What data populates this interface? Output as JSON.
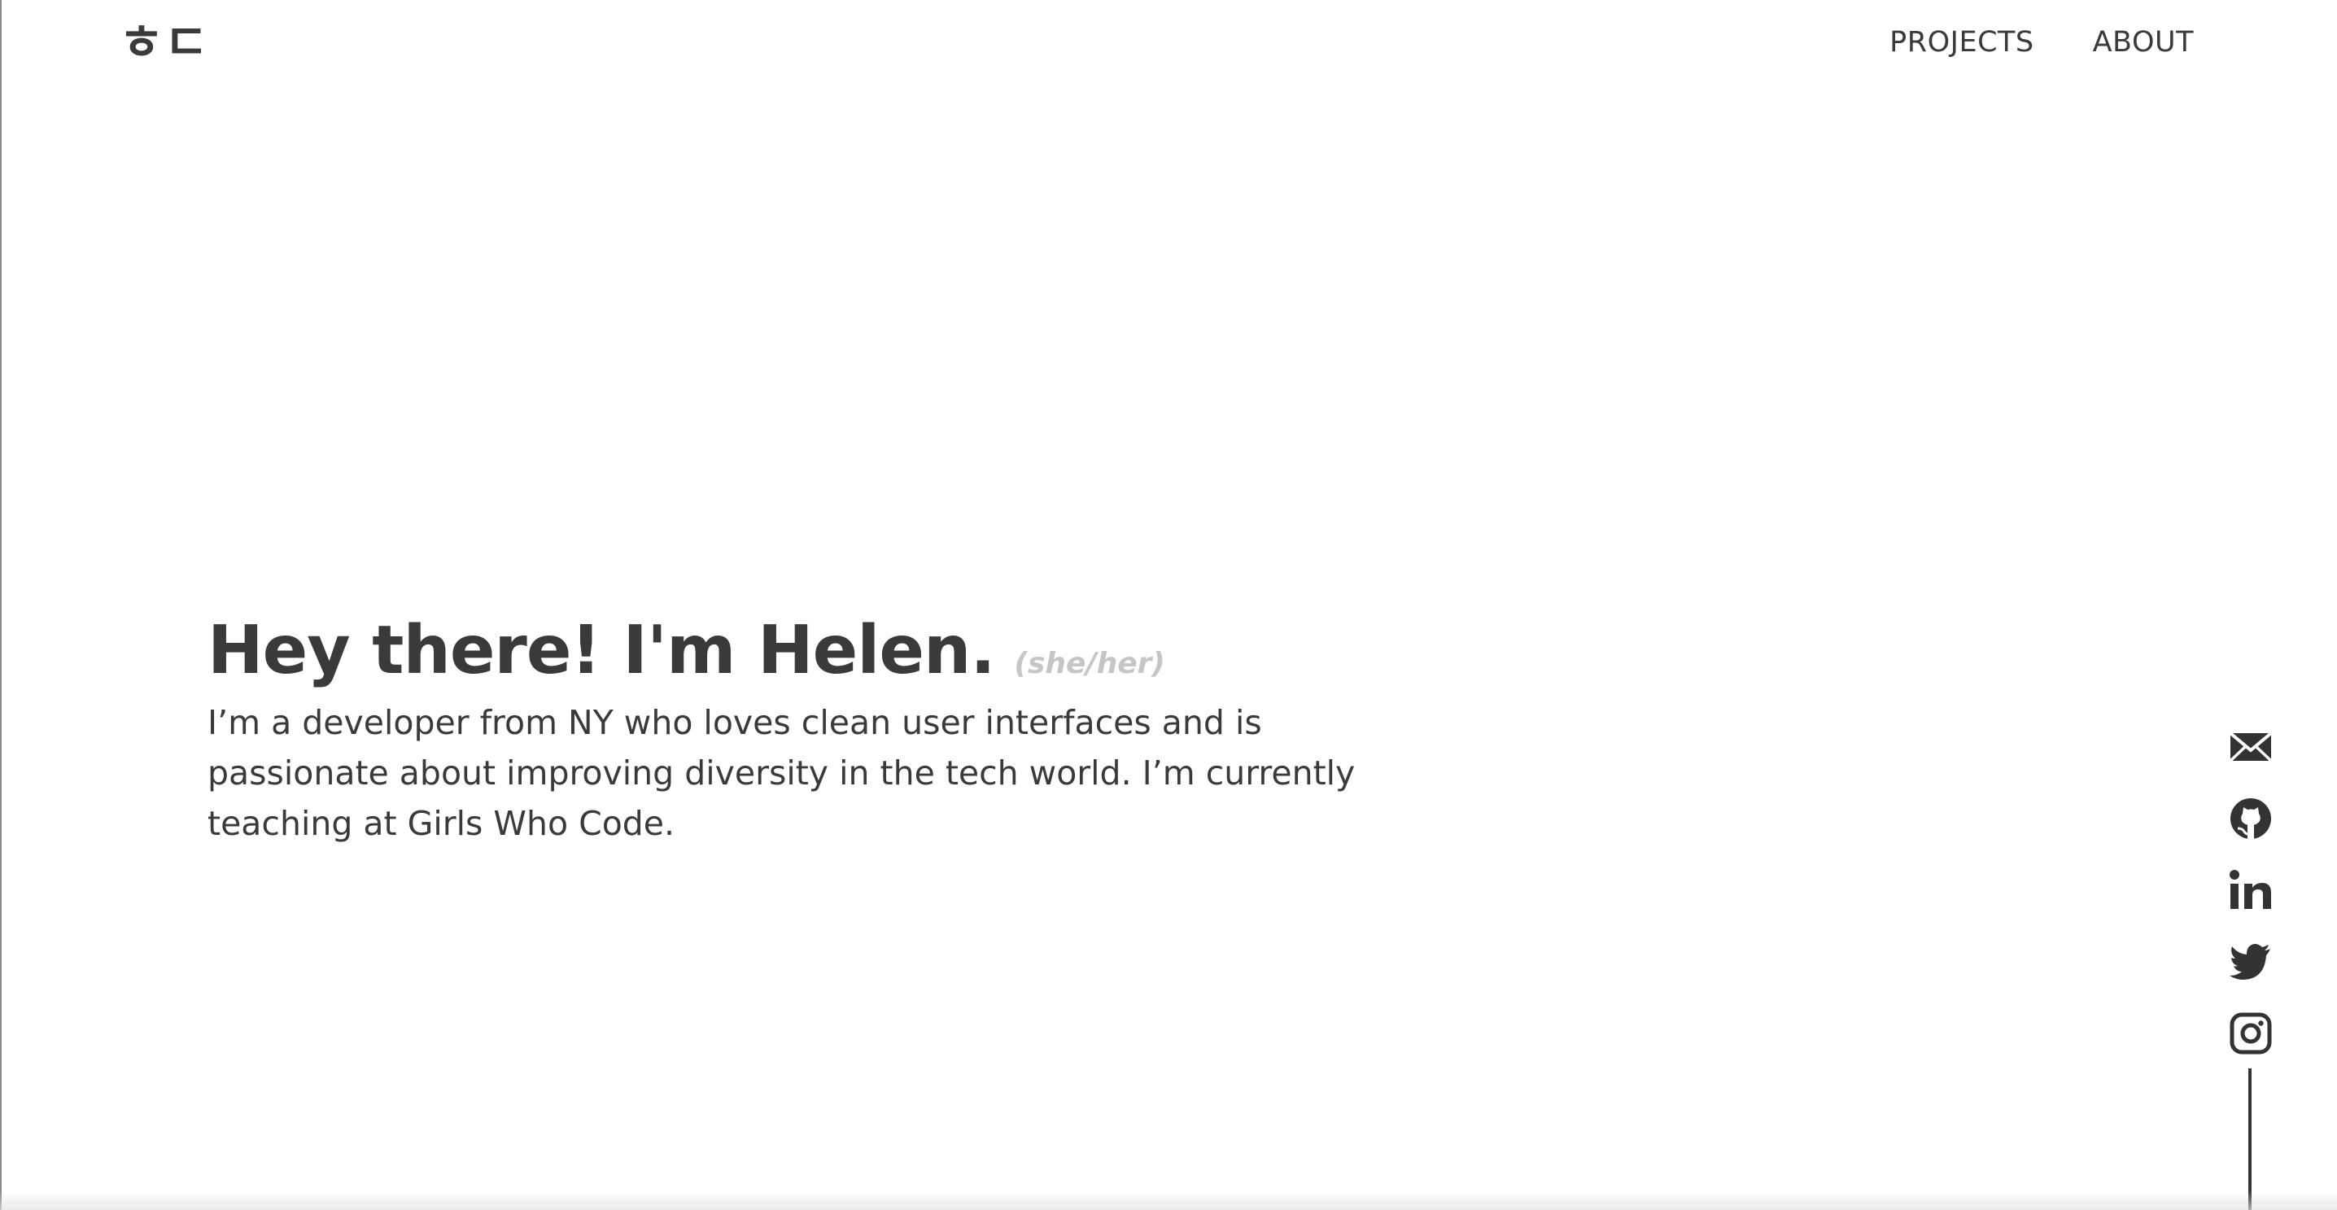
{
  "logo": {
    "text": "ㅎㄷ"
  },
  "nav": {
    "items": [
      {
        "label": "PROJECTS"
      },
      {
        "label": "ABOUT"
      }
    ]
  },
  "hero": {
    "title": "Hey there! I'm Helen.",
    "pronouns": "(she/her)",
    "body": "I’m a developer from NY who loves clean user interfaces and is passionate about improving diversity in the tech world. I’m currently teaching at Girls Who Code."
  },
  "social": {
    "icons": [
      "mail-icon",
      "github-icon",
      "linkedin-icon",
      "twitter-icon",
      "instagram-icon"
    ]
  },
  "colors": {
    "text": "#3a3a3a",
    "muted": "#c6c6c6",
    "background": "#ffffff"
  }
}
